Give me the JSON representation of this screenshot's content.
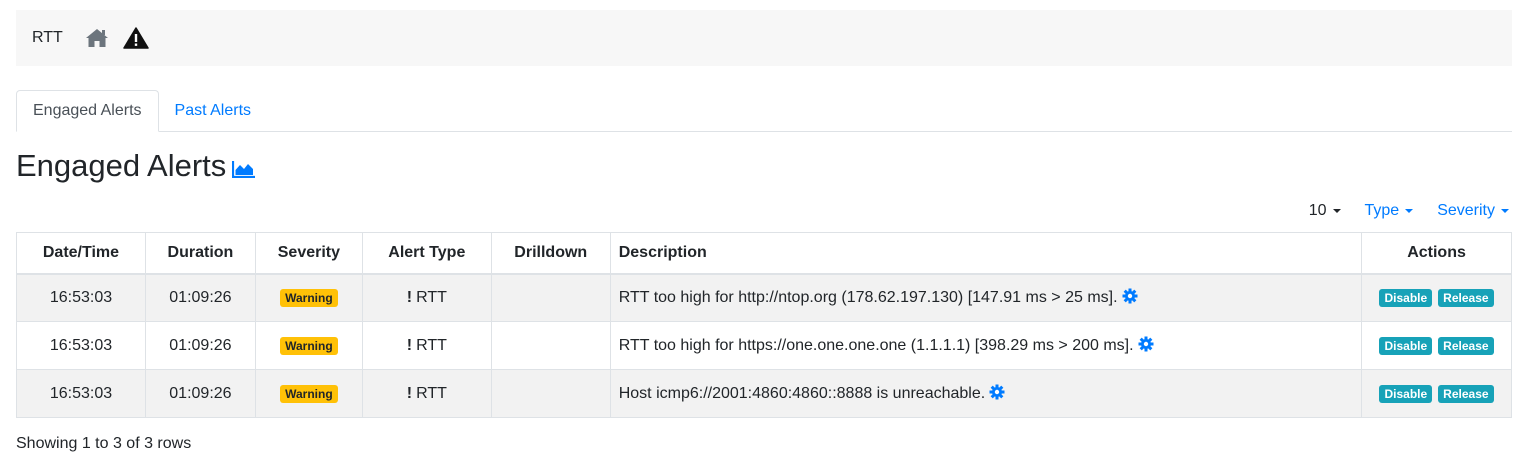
{
  "breadcrumb": {
    "title": "RTT"
  },
  "tabs": [
    {
      "label": "Engaged Alerts"
    },
    {
      "label": "Past Alerts"
    }
  ],
  "page": {
    "heading": "Engaged Alerts"
  },
  "controls": {
    "page_size": "10",
    "type_filter": "Type",
    "severity_filter": "Severity"
  },
  "table": {
    "headers": [
      "Date/Time",
      "Duration",
      "Severity",
      "Alert Type",
      "Drilldown",
      "Description",
      "Actions"
    ],
    "rows": [
      {
        "datetime": "16:53:03",
        "duration": "01:09:26",
        "severity": "Warning",
        "alert_type": "RTT",
        "drilldown": "",
        "description": "RTT too high for http://ntop.org (178.62.197.130) [147.91 ms > 25 ms].",
        "disable": "Disable",
        "release": "Release"
      },
      {
        "datetime": "16:53:03",
        "duration": "01:09:26",
        "severity": "Warning",
        "alert_type": "RTT",
        "drilldown": "",
        "description": "RTT too high for https://one.one.one.one (1.1.1.1) [398.29 ms > 200 ms].",
        "disable": "Disable",
        "release": "Release"
      },
      {
        "datetime": "16:53:03",
        "duration": "01:09:26",
        "severity": "Warning",
        "alert_type": "RTT",
        "drilldown": "",
        "description": "Host icmp6://2001:4860:4860::8888 is unreachable.",
        "disable": "Disable",
        "release": "Release"
      }
    ]
  },
  "footer": {
    "info": "Showing 1 to 3 of 3 rows"
  },
  "colors": {
    "link": "#007bff",
    "warning": "#ffc107",
    "action": "#17a2b8",
    "breadcrumb_bg": "#f7f7f7"
  },
  "icons": {
    "home": "home-icon",
    "warning": "warning-triangle-icon",
    "chart": "area-chart-icon",
    "gear": "gear-icon"
  }
}
